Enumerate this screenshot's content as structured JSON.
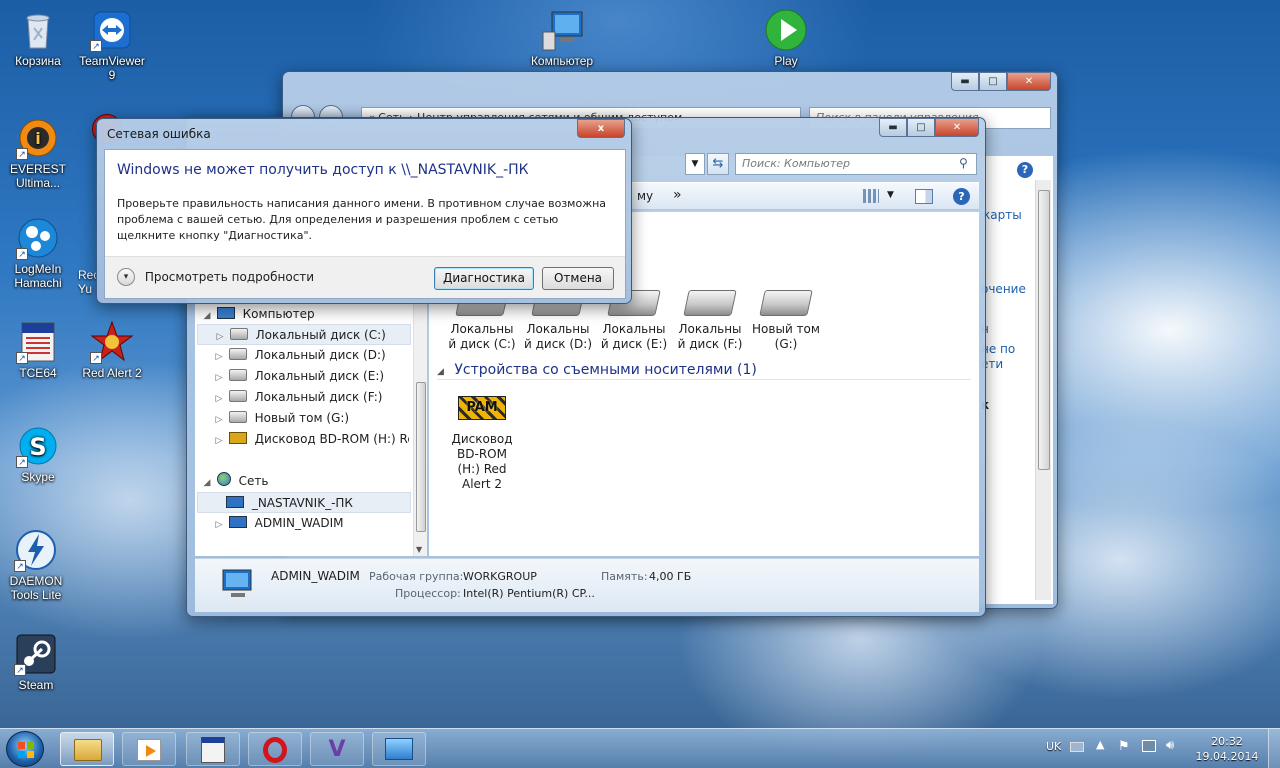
{
  "desktop": {
    "icons": [
      {
        "label": "Корзина",
        "icon": "recycle-bin-icon"
      },
      {
        "label": "TeamViewer 9",
        "icon": "teamviewer-icon"
      },
      {
        "label": "EVEREST Ultima...",
        "icon": "everest-icon"
      },
      {
        "label": "LogMeIn Hamachi",
        "icon": "hamachi-icon"
      },
      {
        "label": "TCE64",
        "icon": "tce64-icon"
      },
      {
        "label": "Red Alert 2",
        "icon": "red-alert-2-icon"
      },
      {
        "label": "Skype",
        "icon": "skype-icon"
      },
      {
        "label": "DAEMON Tools Lite",
        "icon": "daemon-tools-icon"
      },
      {
        "label": "Steam",
        "icon": "steam-icon"
      },
      {
        "label": "Компьютер",
        "icon": "computer-icon"
      },
      {
        "label": "Play",
        "icon": "play-icon"
      }
    ],
    "partial_labels": [
      "Rec",
      "Yu"
    ]
  },
  "back_window": {
    "address": "« Сеть › Центр управления сетями и общим доступом",
    "search_placeholder": "Поиск в панели управления",
    "side_links": [
      "карты",
      "очение",
      "н",
      "не по",
      "ети",
      "к"
    ]
  },
  "explorer": {
    "search_placeholder": "Поиск: Компьютер",
    "toolbar_partial": "му",
    "more_label": "»",
    "tree": {
      "computer_label": "Компьютер",
      "drives": [
        "Локальный диск (C:)",
        "Локальный диск (D:)",
        "Локальный диск (E:)",
        "Локальный диск (F:)",
        "Новый том (G:)",
        "Дисковод BD-ROM (H:) Red Ale"
      ],
      "network_label": "Сеть",
      "network_items": [
        "_NASTAVNIK_-ПК",
        "ADMIN_WADIM"
      ]
    },
    "drives": [
      {
        "name": "Локальны й диск (C:)"
      },
      {
        "name": "Локальны й диск (D:)"
      },
      {
        "name": "Локальны й диск (E:)"
      },
      {
        "name": "Локальны й диск (F:)"
      },
      {
        "name": "Новый том (G:)"
      }
    ],
    "removable_header": "Устройства со съемными носителями (1)",
    "removable": {
      "name": "Дисковод BD-ROM (H:) Red Alert 2",
      "logo": "PAM"
    },
    "details": {
      "computer_name": "ADMIN_WADIM",
      "workgroup_label": "Рабочая группа:",
      "workgroup_value": "WORKGROUP",
      "memory_label": "Память:",
      "memory_value": "4,00 ГБ",
      "cpu_label": "Процессор:",
      "cpu_value": "Intel(R) Pentium(R) CP..."
    }
  },
  "dialog": {
    "title": "Сетевая ошибка",
    "close_glyph": "x",
    "heading": "Windows не может получить доступ к \\\\_NASTAVNIK_-ПК",
    "body": "Проверьте правильность написания данного имени. В противном случае возможна проблема с вашей сетью. Для определения и разрешения проблем с сетью щелкните кнопку \"Диагностика\".",
    "details_label": "Просмотреть подробности",
    "diagnose_button": "Диагностика",
    "cancel_button": "Отмена"
  },
  "taskbar": {
    "language": "UK",
    "time": "20:32",
    "date": "19.04.2014"
  }
}
